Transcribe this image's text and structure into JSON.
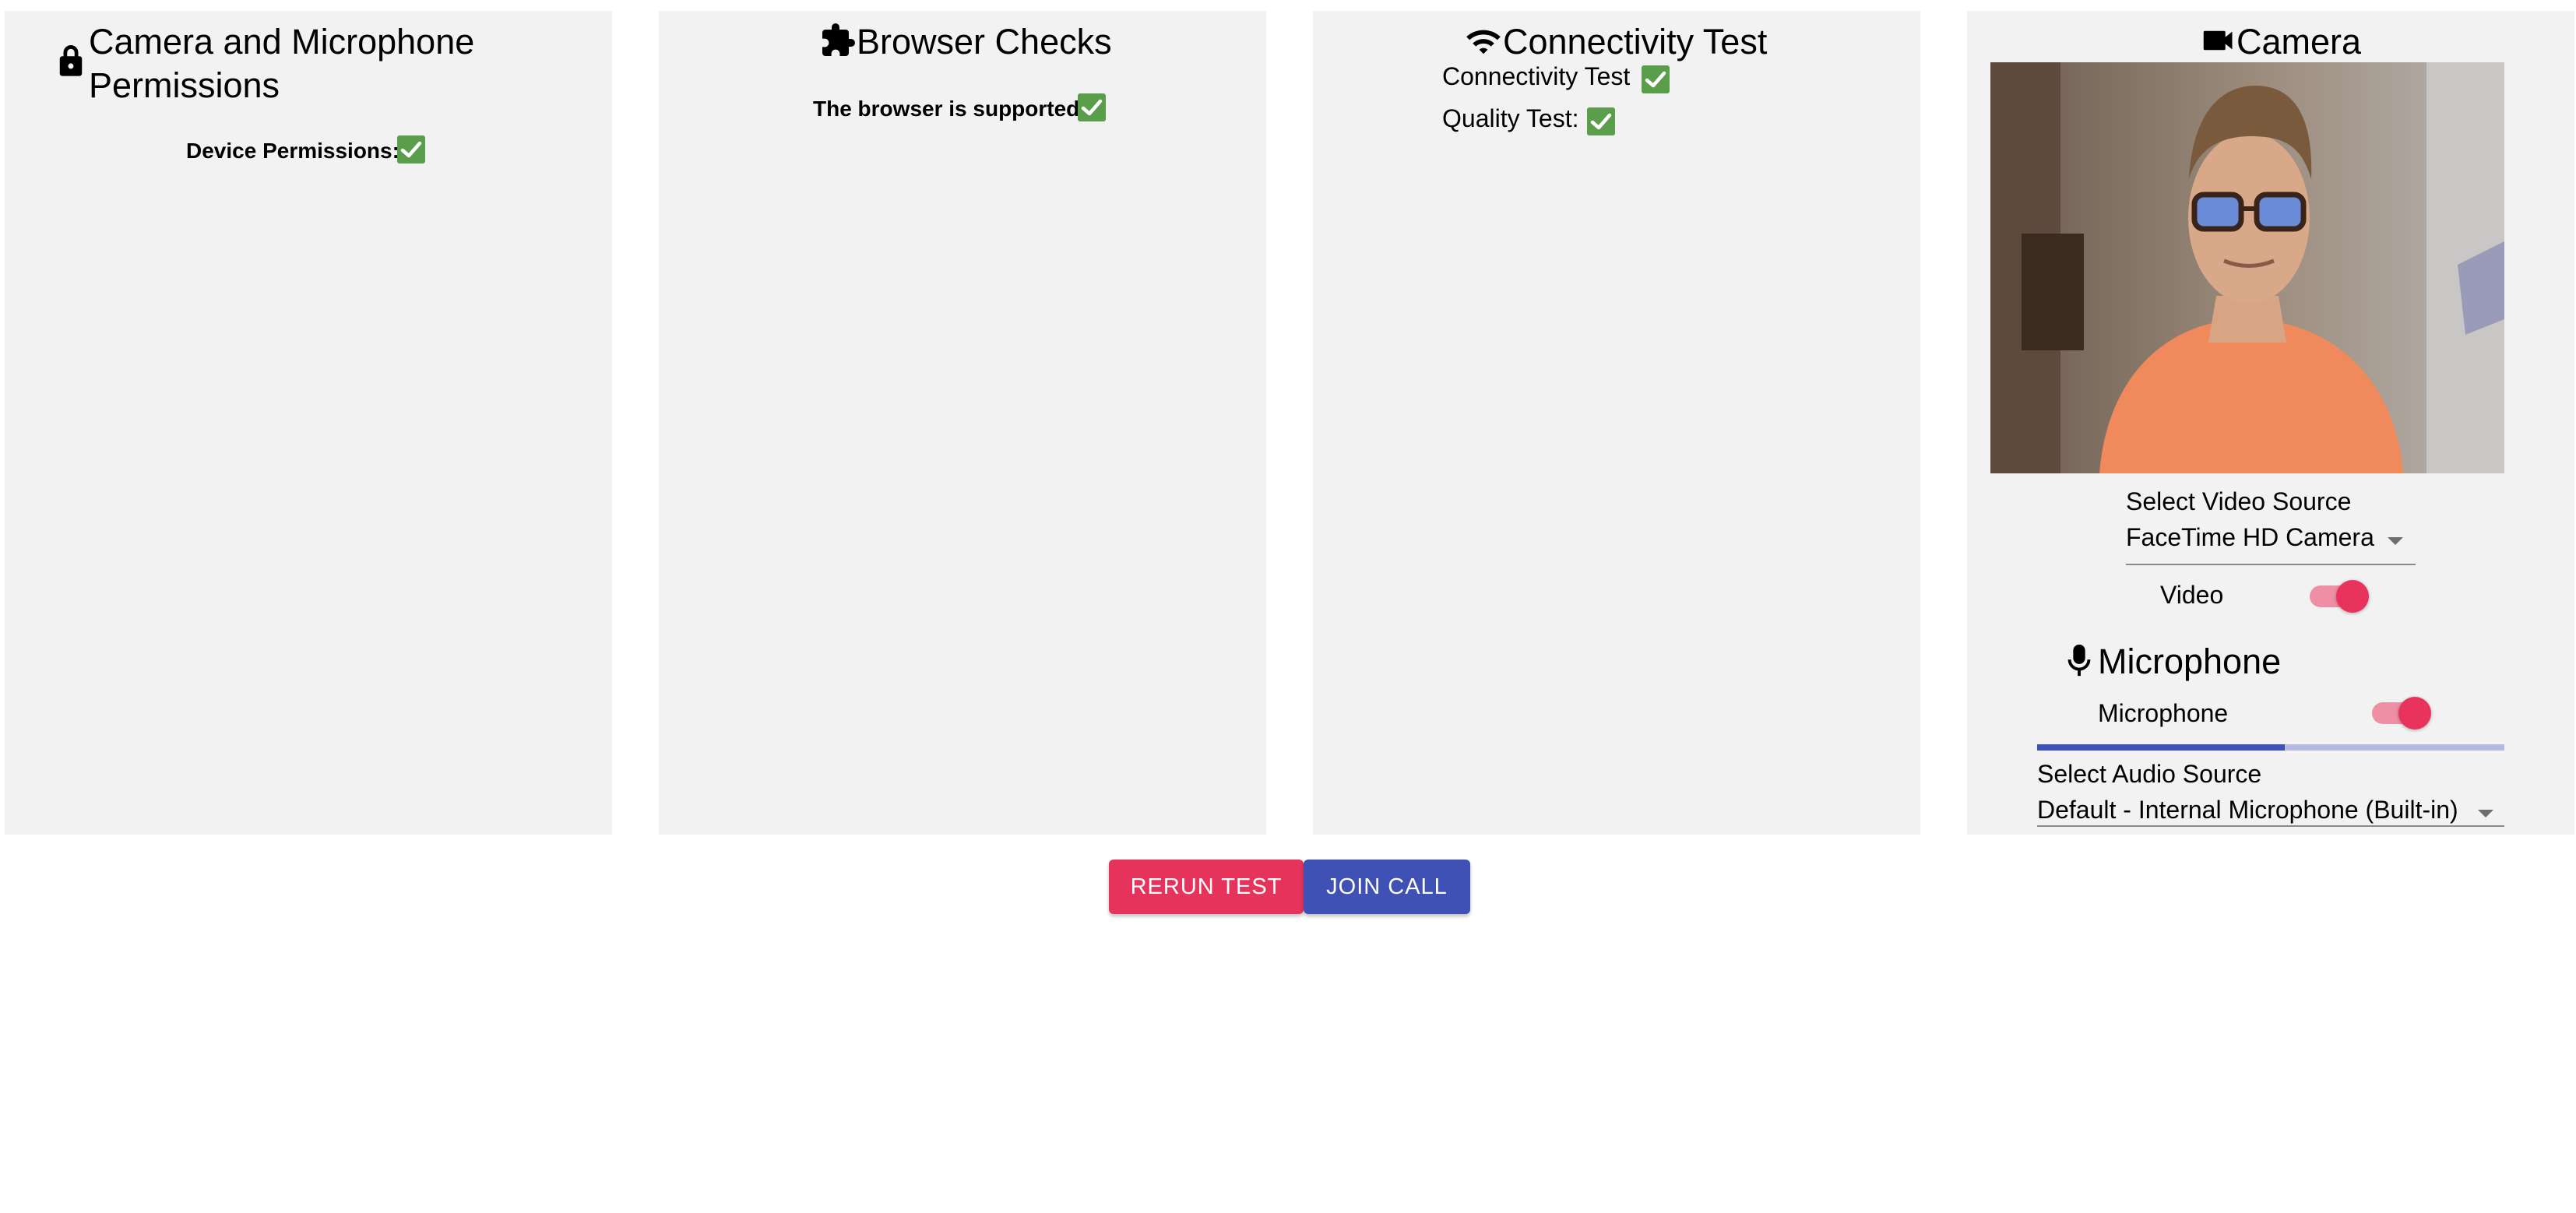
{
  "permissions": {
    "title": "Camera and Microphone Permissions",
    "title_line1": "Camera and Microphone",
    "title_line2": "Permissions",
    "device_label": "Device Permissions:",
    "icon": "lock-icon"
  },
  "browser": {
    "title": "Browser Checks",
    "supported_label": "The browser is supported",
    "icon": "puzzle-icon"
  },
  "connectivity": {
    "title": "Connectivity Test",
    "connectivity_label": "Connectivity Test",
    "quality_label": "Quality Test:",
    "icon": "wifi-icon"
  },
  "camera": {
    "title": "Camera",
    "icon": "videocam-icon",
    "video_source_label": "Select Video Source",
    "video_source_value": "FaceTime HD Camera",
    "video_toggle_label": "Video",
    "video_enabled": true
  },
  "microphone": {
    "title": "Microphone",
    "icon": "mic-icon",
    "toggle_label": "Microphone",
    "enabled": true,
    "audio_level_fraction": 0.53,
    "audio_source_label": "Select Audio Source",
    "audio_source_value": "Default - Internal Microphone (Built-in)"
  },
  "actions": {
    "rerun_label": "RERUN TEST",
    "join_label": "JOIN CALL"
  },
  "colors": {
    "check_green": "#5a9e4b",
    "accent_pink": "#e6335c",
    "primary_indigo": "#3f51b5",
    "panel_bg": "#f2f2f2"
  }
}
